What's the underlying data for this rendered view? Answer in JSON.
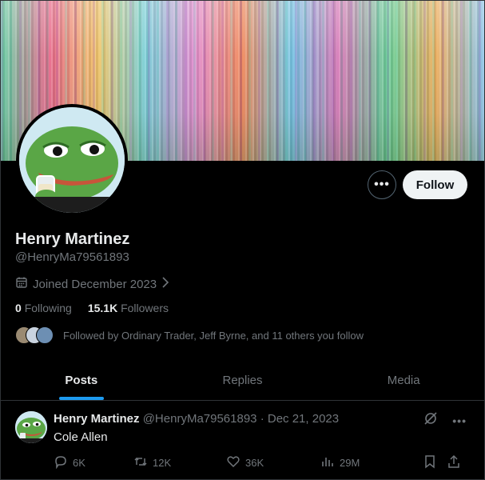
{
  "profile": {
    "name": "Henry Martinez",
    "handle": "@HenryMa79561893",
    "joined": "Joined December 2023",
    "following_count": "0",
    "following_label": "Following",
    "followers_count": "15.1K",
    "followers_label": "Followers",
    "followed_by": "Followed by Ordinary Trader, Jeff Byrne, and 11 others you follow"
  },
  "actions": {
    "follow_label": "Follow",
    "more_icon": "more-icon"
  },
  "tabs": [
    {
      "label": "Posts",
      "active": true
    },
    {
      "label": "Replies",
      "active": false
    },
    {
      "label": "Media",
      "active": false
    }
  ],
  "tweet": {
    "name": "Henry Martinez",
    "handle": "@HenryMa79561893",
    "separator": "·",
    "date": "Dec 21, 2023",
    "text": "Cole Allen",
    "replies": "6K",
    "reposts": "12K",
    "likes": "36K",
    "views": "29M"
  },
  "colors": {
    "accent": "#1d9bf0",
    "background": "#000000",
    "text": "#e7e9ea",
    "muted": "#71767b",
    "border": "#2f3336",
    "follow_bg": "#eff3f4"
  }
}
